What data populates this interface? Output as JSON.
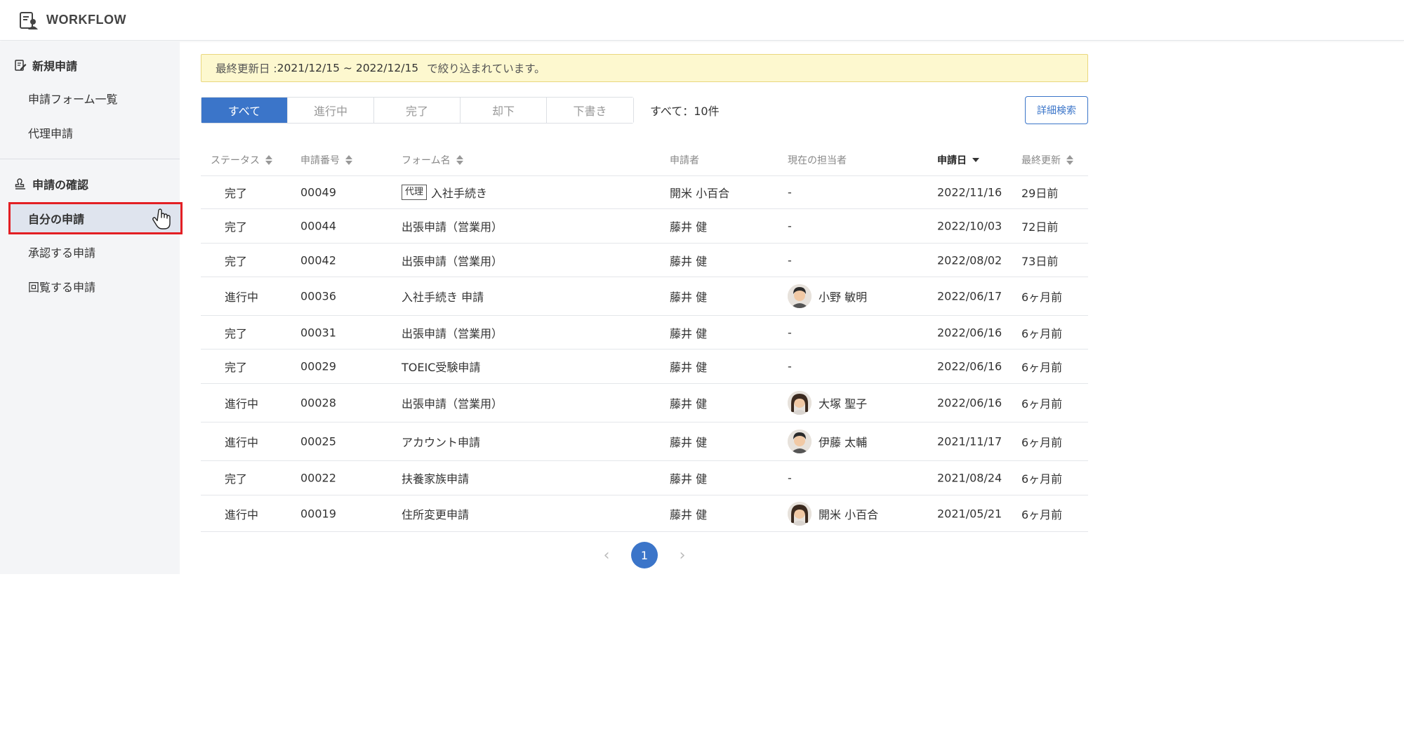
{
  "app": {
    "name": "WORKFLOW"
  },
  "sidebar": {
    "sections": [
      {
        "title": "新規申請",
        "icon": "edit-form-icon",
        "items": [
          {
            "label": "申請フォーム一覧"
          },
          {
            "label": "代理申請"
          }
        ]
      },
      {
        "title": "申請の確認",
        "icon": "stamp-icon",
        "items": [
          {
            "label": "自分の申請",
            "active": true
          },
          {
            "label": "承認する申請"
          },
          {
            "label": "回覧する申請"
          }
        ]
      }
    ]
  },
  "filter_notice": {
    "label": "最終更新日 : ",
    "value": "2021/12/15 ~ 2022/12/15",
    "suffix": "で絞り込まれています。"
  },
  "tabs": [
    {
      "label": "すべて",
      "active": true
    },
    {
      "label": "進行中"
    },
    {
      "label": "完了"
    },
    {
      "label": "却下"
    },
    {
      "label": "下書き"
    }
  ],
  "count_text": "すべて：10件",
  "advanced_search_label": "詳細検索",
  "table": {
    "columns": [
      "ステータス",
      "申請番号",
      "フォーム名",
      "申請者",
      "現在の担当者",
      "申請日",
      "最終更新"
    ],
    "sorted_column": "申請日",
    "rows": [
      {
        "status": "完了",
        "number": "00049",
        "form_tag": "代理",
        "form": "入社手続き",
        "applicant": "開米 小百合",
        "assignee": "-",
        "avatar": "",
        "date": "2022/11/16",
        "updated": "29日前"
      },
      {
        "status": "完了",
        "number": "00044",
        "form_tag": "",
        "form": "出張申請（営業用）",
        "applicant": "藤井 健",
        "assignee": "-",
        "avatar": "",
        "date": "2022/10/03",
        "updated": "72日前"
      },
      {
        "status": "完了",
        "number": "00042",
        "form_tag": "",
        "form": "出張申請（営業用）",
        "applicant": "藤井 健",
        "assignee": "-",
        "avatar": "",
        "date": "2022/08/02",
        "updated": "73日前"
      },
      {
        "status": "進行中",
        "number": "00036",
        "form_tag": "",
        "form": "入社手続き 申請",
        "applicant": "藤井 健",
        "assignee": "小野 敏明",
        "avatar": "male",
        "date": "2022/06/17",
        "updated": "6ヶ月前"
      },
      {
        "status": "完了",
        "number": "00031",
        "form_tag": "",
        "form": "出張申請（営業用）",
        "applicant": "藤井 健",
        "assignee": "-",
        "avatar": "",
        "date": "2022/06/16",
        "updated": "6ヶ月前"
      },
      {
        "status": "完了",
        "number": "00029",
        "form_tag": "",
        "form": "TOEIC受験申請",
        "applicant": "藤井 健",
        "assignee": "-",
        "avatar": "",
        "date": "2022/06/16",
        "updated": "6ヶ月前"
      },
      {
        "status": "進行中",
        "number": "00028",
        "form_tag": "",
        "form": "出張申請（営業用）",
        "applicant": "藤井 健",
        "assignee": "大塚 聖子",
        "avatar": "female",
        "date": "2022/06/16",
        "updated": "6ヶ月前"
      },
      {
        "status": "進行中",
        "number": "00025",
        "form_tag": "",
        "form": "アカウント申請",
        "applicant": "藤井 健",
        "assignee": "伊藤 太輔",
        "avatar": "male",
        "date": "2021/11/17",
        "updated": "6ヶ月前"
      },
      {
        "status": "完了",
        "number": "00022",
        "form_tag": "",
        "form": "扶養家族申請",
        "applicant": "藤井 健",
        "assignee": "-",
        "avatar": "",
        "date": "2021/08/24",
        "updated": "6ヶ月前"
      },
      {
        "status": "進行中",
        "number": "00019",
        "form_tag": "",
        "form": "住所変更申請",
        "applicant": "藤井 健",
        "assignee": "開米 小百合",
        "avatar": "female",
        "date": "2021/05/21",
        "updated": "6ヶ月前"
      }
    ]
  },
  "pagination": {
    "current": "1"
  },
  "colors": {
    "accent": "#3b75c9",
    "highlight": "#e31f24",
    "notice_bg": "#fdf8cf"
  }
}
